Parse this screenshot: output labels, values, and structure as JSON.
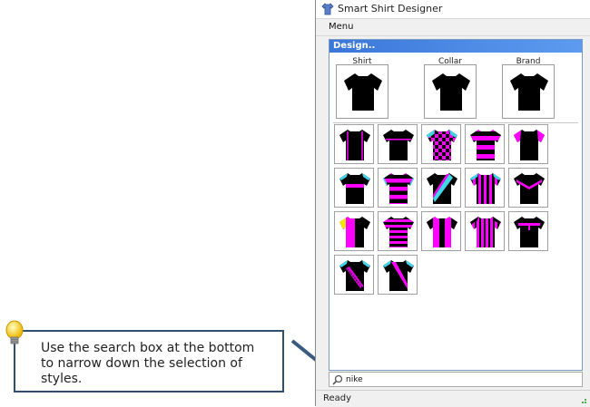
{
  "window": {
    "title": "Smart Shirt Designer"
  },
  "menu": {
    "items": [
      "Menu"
    ]
  },
  "panel": {
    "header": "Design..",
    "slots": [
      {
        "label": "Shirt",
        "icon": "black-shirt-icon"
      },
      {
        "label": "Collar",
        "icon": "black-shirt-icon"
      },
      {
        "label": "Brand",
        "icon": "black-shirt-icon"
      }
    ]
  },
  "styles": [
    "black-pink-piping",
    "black-chest-stripe",
    "pink-black-checkered",
    "pink-black-hoops",
    "black-pink-sleeves",
    "black-cyan-band",
    "pink-black-hoops-cyan-cuffs",
    "black-cyan-sash",
    "pink-black-vertical-stripes",
    "black-pink-chevron",
    "yellow-black-half",
    "pink-black-thin-hoops",
    "pink-black-center-stripe",
    "pink-black-pinstripes",
    "black-pink-yoke",
    "black-pink-dotted-sash",
    "black-pink-sash"
  ],
  "search": {
    "value": "nike",
    "placeholder": ""
  },
  "status": {
    "text": "Ready"
  },
  "callout": {
    "text": "Use the search box at the bottom to narrow down the selection of styles."
  },
  "colors": {
    "accent_blue": "#3a77d9",
    "pink": "#ff00ff",
    "cyan": "#3fd7e6",
    "yellow": "#f2e600",
    "callout_border": "#2f4f70"
  }
}
